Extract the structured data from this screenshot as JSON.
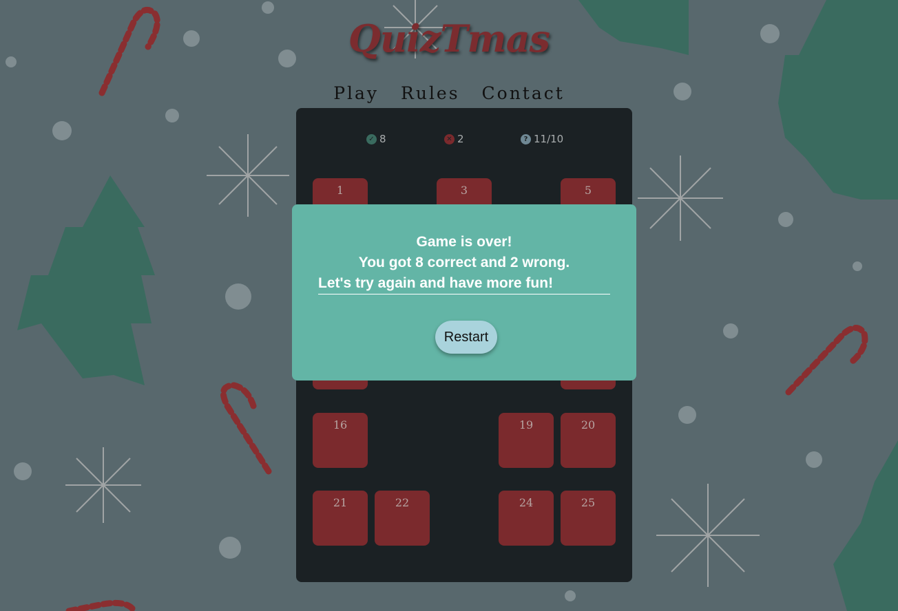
{
  "header": {
    "logo_text": "QuizTmas",
    "nav": [
      "Play",
      "Rules",
      "Contact"
    ]
  },
  "score": {
    "correct": "8",
    "wrong": "2",
    "question": "11/10",
    "correct_icon": "check-circle-icon",
    "wrong_icon": "x-circle-icon",
    "question_icon": "question-circle-icon"
  },
  "tiles": [
    "1",
    "3",
    "5",
    "16",
    "19",
    "20",
    "21",
    "22",
    "24",
    "25"
  ],
  "modal": {
    "line1": "Game is over!",
    "line2": "You got 8 correct and 2 wrong.",
    "line3": "Let's try again and have more fun!",
    "restart_label": "Restart"
  },
  "colors": {
    "background": "#58686d",
    "board": "#1b2124",
    "tile": "#7b2a2d",
    "modal": "#63b5a6",
    "restart_button": "#a9d3dc",
    "logo": "#7b2c2f",
    "tree": "#3a6b5f"
  }
}
